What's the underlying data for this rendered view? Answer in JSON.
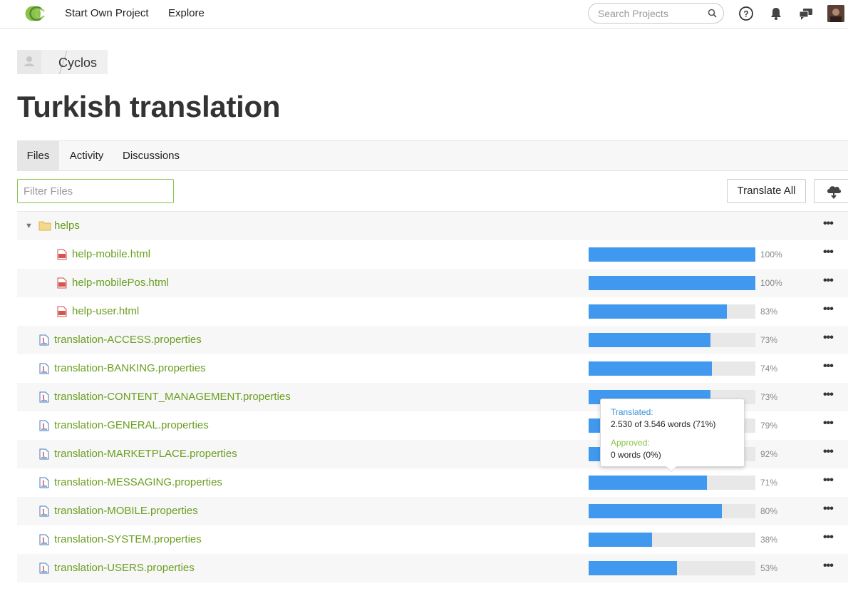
{
  "nav": {
    "links": [
      "Start Own Project",
      "Explore"
    ],
    "search_placeholder": "Search Projects",
    "icons": [
      "help-icon",
      "notifications-icon",
      "messages-icon"
    ]
  },
  "breadcrumb": {
    "project": "Cyclos"
  },
  "page_title": "Turkish translation",
  "tabs": [
    "Files",
    "Activity",
    "Discussions"
  ],
  "active_tab": "Files",
  "toolbar": {
    "filter_placeholder": "Filter Files",
    "translate_all": "Translate All",
    "download_icon": "cloud-download-icon"
  },
  "files": [
    {
      "name": "helps",
      "type": "folder",
      "expanded": true
    },
    {
      "name": "help-mobile.html",
      "type": "html",
      "progress": 100,
      "pct_label": "100%"
    },
    {
      "name": "help-mobilePos.html",
      "type": "html",
      "progress": 100,
      "pct_label": "100%"
    },
    {
      "name": "help-user.html",
      "type": "html",
      "progress": 83,
      "pct_label": "83%"
    },
    {
      "name": "translation-ACCESS.properties",
      "type": "properties",
      "progress": 73,
      "pct_label": "73%"
    },
    {
      "name": "translation-BANKING.properties",
      "type": "properties",
      "progress": 74,
      "pct_label": "74%"
    },
    {
      "name": "translation-CONTENT_MANAGEMENT.properties",
      "type": "properties",
      "progress": 73,
      "pct_label": "73%"
    },
    {
      "name": "translation-GENERAL.properties",
      "type": "properties",
      "progress": 79,
      "pct_label": "79%"
    },
    {
      "name": "translation-MARKETPLACE.properties",
      "type": "properties",
      "progress": 92,
      "pct_label": "92%"
    },
    {
      "name": "translation-MESSAGING.properties",
      "type": "properties",
      "progress": 71,
      "pct_label": "71%"
    },
    {
      "name": "translation-MOBILE.properties",
      "type": "properties",
      "progress": 80,
      "pct_label": "80%"
    },
    {
      "name": "translation-SYSTEM.properties",
      "type": "properties",
      "progress": 38,
      "pct_label": "38%"
    },
    {
      "name": "translation-USERS.properties",
      "type": "properties",
      "progress": 53,
      "pct_label": "53%"
    }
  ],
  "tooltip": {
    "translated_label": "Translated:",
    "translated_value": "2.530 of 3.546 words (71%)",
    "approved_label": "Approved:",
    "approved_value": "0 words (0%)"
  },
  "colors": {
    "link": "#6a9e1f",
    "progress": "#4099ee",
    "accent": "#8bc34a"
  }
}
